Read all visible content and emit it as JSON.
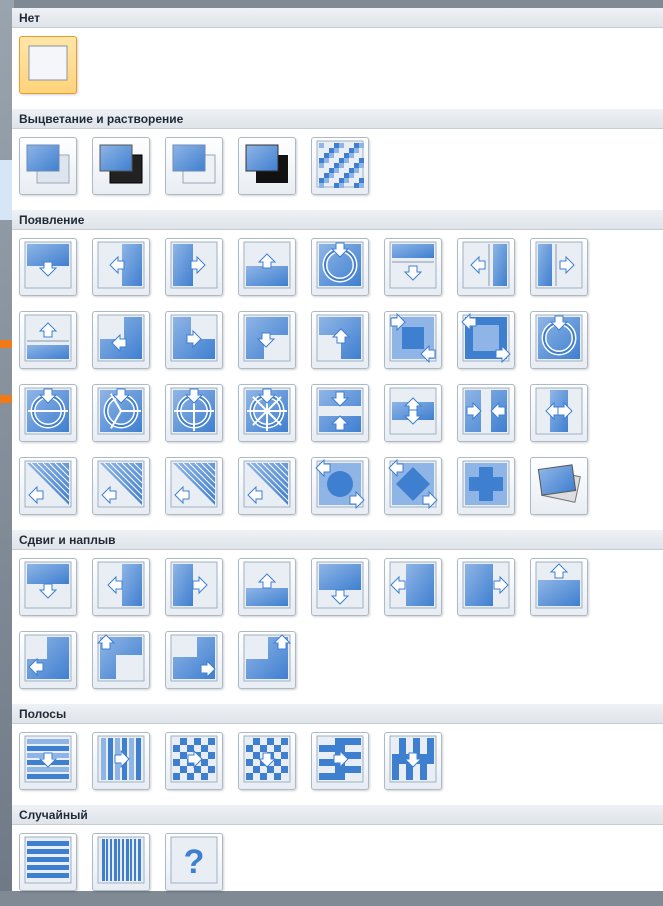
{
  "sections": [
    {
      "title": "Нет",
      "tiles": [
        {
          "name": "none-effect-icon",
          "kind": "none",
          "selected": true
        }
      ]
    },
    {
      "title": "Выцветание и растворение",
      "tiles": [
        {
          "name": "fade-smooth-icon",
          "kind": "stack-light"
        },
        {
          "name": "fade-through-black-icon",
          "kind": "stack-dark"
        },
        {
          "name": "cut-icon",
          "kind": "stack-light2"
        },
        {
          "name": "cut-through-black-icon",
          "kind": "stack-black"
        },
        {
          "name": "dissolve-icon",
          "kind": "dissolve"
        }
      ]
    },
    {
      "title": "Появление",
      "tiles": [
        {
          "name": "wipe-down-icon",
          "kind": "arrow-down-top"
        },
        {
          "name": "wipe-left-icon",
          "kind": "arrow-left"
        },
        {
          "name": "wipe-right-icon",
          "kind": "arrow-right"
        },
        {
          "name": "wipe-up-icon",
          "kind": "arrow-up"
        },
        {
          "name": "wheel-icon",
          "kind": "wheel"
        },
        {
          "name": "push-down-icon",
          "kind": "split-down"
        },
        {
          "name": "push-left-icon",
          "kind": "split-left"
        },
        {
          "name": "push-right-icon",
          "kind": "split-right"
        },
        {
          "name": "push-up-icon",
          "kind": "split-up"
        },
        {
          "name": "wipe-left-down-icon",
          "kind": "corner-ld"
        },
        {
          "name": "wipe-right-down-icon",
          "kind": "corner-rd"
        },
        {
          "name": "wipe-down-right-icon",
          "kind": "corner-dr"
        },
        {
          "name": "wipe-left-up-icon",
          "kind": "corner-lu"
        },
        {
          "name": "box-in-icon",
          "kind": "box-in"
        },
        {
          "name": "box-out-icon",
          "kind": "box-out"
        },
        {
          "name": "wheel-clockwise-icon",
          "kind": "wheel2"
        },
        {
          "name": "wheel-2-spokes-icon",
          "kind": "wheel3"
        },
        {
          "name": "wheel-3-spokes-icon",
          "kind": "wheel4"
        },
        {
          "name": "wheel-4-spokes-icon",
          "kind": "wheel5"
        },
        {
          "name": "wheel-8-spokes-icon",
          "kind": "wheel6"
        },
        {
          "name": "split-horizontal-in-icon",
          "kind": "hsplit-in"
        },
        {
          "name": "split-horizontal-out-icon",
          "kind": "hsplit-out"
        },
        {
          "name": "split-vertical-in-icon",
          "kind": "vsplit-in"
        },
        {
          "name": "split-vertical-out-icon",
          "kind": "vsplit-out"
        },
        {
          "name": "strips-left-down-icon",
          "kind": "strips1"
        },
        {
          "name": "strips-right-up-icon",
          "kind": "strips2"
        },
        {
          "name": "strips-left-up-icon",
          "kind": "strips3"
        },
        {
          "name": "strips-right-down-icon",
          "kind": "strips4"
        },
        {
          "name": "circle-icon",
          "kind": "circle"
        },
        {
          "name": "diamond-icon",
          "kind": "diamond"
        },
        {
          "name": "plus-icon",
          "kind": "plus"
        },
        {
          "name": "newsflash-icon",
          "kind": "photos"
        }
      ]
    },
    {
      "title": "Сдвиг и наплыв",
      "tiles": [
        {
          "name": "cover-down-icon",
          "kind": "cover-down"
        },
        {
          "name": "cover-left-icon",
          "kind": "cover-left"
        },
        {
          "name": "cover-right-icon",
          "kind": "cover-right"
        },
        {
          "name": "cover-up-icon",
          "kind": "cover-up"
        },
        {
          "name": "uncover-down-icon",
          "kind": "uncover-down"
        },
        {
          "name": "uncover-left-icon",
          "kind": "uncover-left"
        },
        {
          "name": "uncover-right-icon",
          "kind": "uncover-right"
        },
        {
          "name": "uncover-up-icon",
          "kind": "uncover-up"
        },
        {
          "name": "cover-left-down-icon",
          "kind": "cover-ld"
        },
        {
          "name": "cover-right-up-icon",
          "kind": "cover-ru"
        },
        {
          "name": "cover-left-up-icon",
          "kind": "cover-lu"
        },
        {
          "name": "cover-right-down-icon",
          "kind": "cover-rd"
        }
      ]
    },
    {
      "title": "Полосы",
      "tiles": [
        {
          "name": "blinds-horizontal-icon",
          "kind": "blinds-h"
        },
        {
          "name": "blinds-vertical-icon",
          "kind": "blinds-v"
        },
        {
          "name": "checkerboard-across-icon",
          "kind": "checker-a"
        },
        {
          "name": "checkerboard-down-icon",
          "kind": "checker-d"
        },
        {
          "name": "comb-horizontal-icon",
          "kind": "comb-h"
        },
        {
          "name": "comb-vertical-icon",
          "kind": "comb-v"
        }
      ]
    },
    {
      "title": "Случайный",
      "tiles": [
        {
          "name": "random-bars-horizontal-icon",
          "kind": "bars-h"
        },
        {
          "name": "random-bars-vertical-icon",
          "kind": "bars-v"
        },
        {
          "name": "random-transition-icon",
          "kind": "question"
        }
      ]
    }
  ],
  "colors": {
    "blue": "#3f7fd0",
    "blueLight": "#8fb5e6",
    "frame": "#e9eef4",
    "dark": "#222222"
  }
}
